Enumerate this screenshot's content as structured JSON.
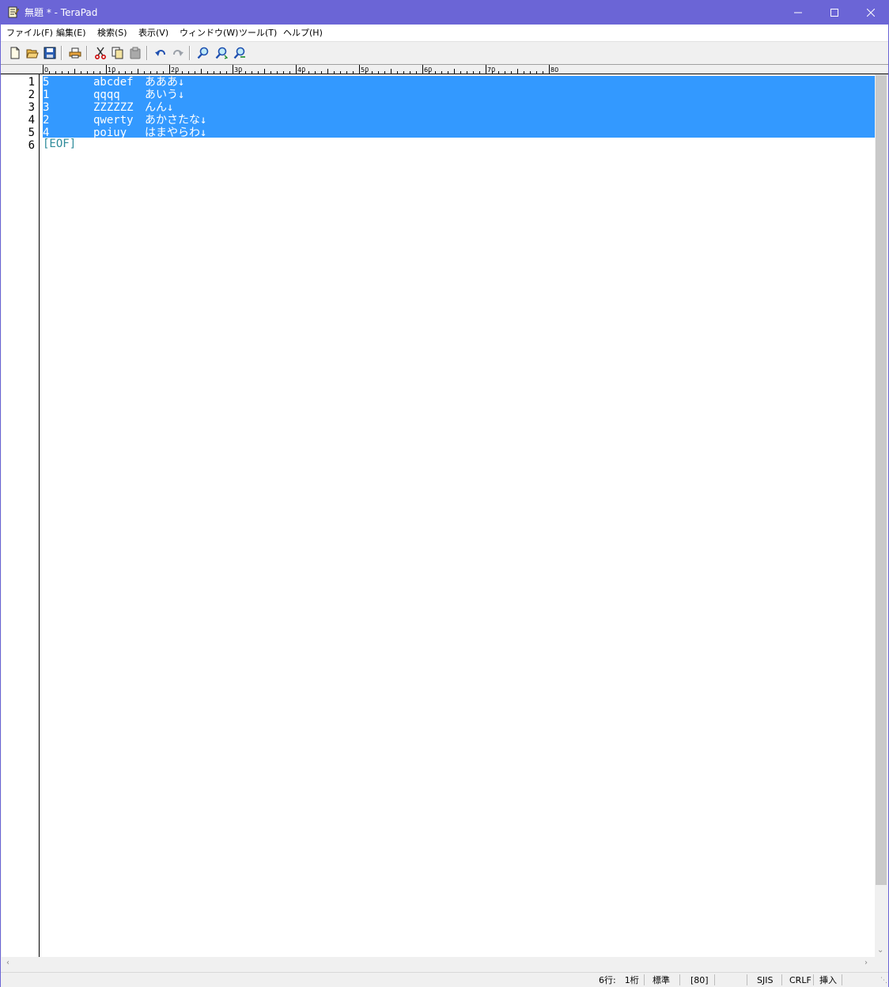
{
  "window": {
    "title": "無題 * - TeraPad",
    "controls": {
      "minimize": "minimize-icon",
      "maximize": "maximize-icon",
      "close": "close-icon"
    },
    "accent_color": "#6b65d6"
  },
  "menu": [
    {
      "label": "ファイル(F)"
    },
    {
      "label": "編集(E)"
    },
    {
      "label": "検索(S)"
    },
    {
      "label": "表示(V)"
    },
    {
      "label": "ウィンドウ(W)"
    },
    {
      "label": "ツール(T)"
    },
    {
      "label": "ヘルプ(H)"
    }
  ],
  "toolbar": {
    "icons": [
      "new-file-icon",
      "open-folder-icon",
      "save-icon",
      "print-icon",
      "cut-icon",
      "copy-icon",
      "paste-icon",
      "undo-icon",
      "redo-icon",
      "find-icon",
      "find-next-icon",
      "find-prev-icon"
    ]
  },
  "ruler": {
    "marks": [
      "0",
      "10",
      "20",
      "30",
      "40",
      "50",
      "60",
      "70",
      "80"
    ]
  },
  "editor": {
    "selection_color": "#3399ff",
    "lines": [
      {
        "num": "1",
        "c1": "5",
        "c2": "abcdef",
        "c3": "あああ↓"
      },
      {
        "num": "2",
        "c1": "1",
        "c2": "qqqq",
        "c3": "あいう↓"
      },
      {
        "num": "3",
        "c1": "3",
        "c2": "ZZZZZZ",
        "c3": "んん↓"
      },
      {
        "num": "4",
        "c1": "2",
        "c2": "qwerty",
        "c3": "あかさたな↓"
      },
      {
        "num": "5",
        "c1": "4",
        "c2": "poiuy",
        "c3": "はまやらわ↓"
      }
    ],
    "eof_line": {
      "num": "6",
      "text": "[EOF]"
    }
  },
  "status": {
    "position": "6行:　1桁",
    "mode": "標準",
    "width": "[80]",
    "encoding": "SJIS",
    "line_ending": "CRLF",
    "insert_mode": "挿入"
  }
}
